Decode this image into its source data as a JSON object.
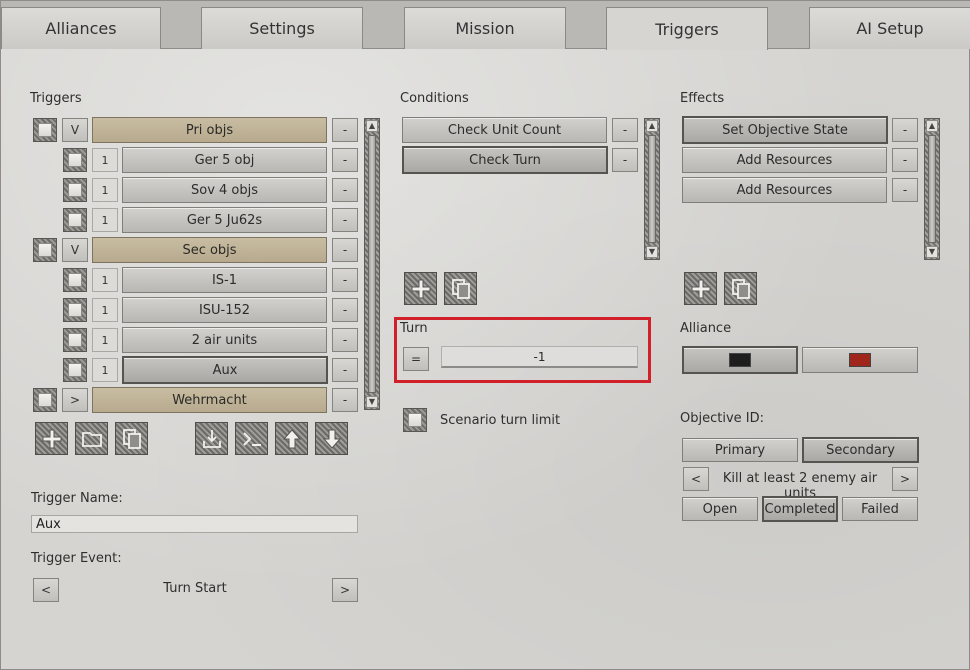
{
  "tabs": [
    {
      "label": "Alliances",
      "active": false
    },
    {
      "label": "Settings",
      "active": false
    },
    {
      "label": "Mission",
      "active": false
    },
    {
      "label": "Triggers",
      "active": true
    },
    {
      "label": "AI Setup",
      "active": false
    }
  ],
  "triggers": {
    "title": "Triggers",
    "rows": [
      {
        "kind": "group",
        "toggle": "V",
        "label": "Pri objs",
        "remove": "-"
      },
      {
        "kind": "item",
        "count": "1",
        "label": "Ger 5 obj",
        "remove": "-"
      },
      {
        "kind": "item",
        "count": "1",
        "label": "Sov 4 objs",
        "remove": "-"
      },
      {
        "kind": "item",
        "count": "1",
        "label": "Ger 5 Ju62s",
        "remove": "-"
      },
      {
        "kind": "group",
        "toggle": "V",
        "label": "Sec objs",
        "remove": "-"
      },
      {
        "kind": "item",
        "count": "1",
        "label": "IS-1",
        "remove": "-"
      },
      {
        "kind": "item",
        "count": "1",
        "label": "ISU-152",
        "remove": "-"
      },
      {
        "kind": "item",
        "count": "1",
        "label": "2 air units",
        "remove": "-"
      },
      {
        "kind": "item",
        "count": "1",
        "label": "Aux",
        "remove": "-",
        "selected": true
      },
      {
        "kind": "group",
        "toggle": ">",
        "label": "Wehrmacht",
        "remove": "-"
      }
    ],
    "toolbar_icons": [
      "add-icon",
      "folder-icon",
      "copy-icon",
      "import-icon",
      "console-icon",
      "move-up-icon",
      "move-down-icon"
    ],
    "name_label": "Trigger Name:",
    "name_value": "Aux",
    "event_label": "Trigger Event:",
    "event_prev": "<",
    "event_value": "Turn Start",
    "event_next": ">"
  },
  "conditions": {
    "title": "Conditions",
    "rows": [
      {
        "label": "Check Unit Count",
        "remove": "-"
      },
      {
        "label": "Check Turn",
        "remove": "-",
        "selected": true
      }
    ],
    "turn": {
      "label": "Turn",
      "operator": "=",
      "value": "-1",
      "highlight_color": "#d2202a"
    },
    "scenario_limit_label": "Scenario turn limit"
  },
  "effects": {
    "title": "Effects",
    "rows": [
      {
        "label": "Set Objective State",
        "remove": "-",
        "selected": true
      },
      {
        "label": "Add Resources",
        "remove": "-"
      },
      {
        "label": "Add Resources",
        "remove": "-"
      }
    ],
    "alliance": {
      "label": "Alliance",
      "colors": [
        "#1e1e1e",
        "#a0261c"
      ]
    },
    "objective": {
      "label": "Objective ID:",
      "types": [
        "Primary",
        "Secondary"
      ],
      "selected_type": "Secondary",
      "prev": "<",
      "next": ">",
      "value": "Kill at least 2 enemy air units",
      "states": [
        "Open",
        "Completed",
        "Failed"
      ],
      "selected_state": "Completed"
    }
  }
}
